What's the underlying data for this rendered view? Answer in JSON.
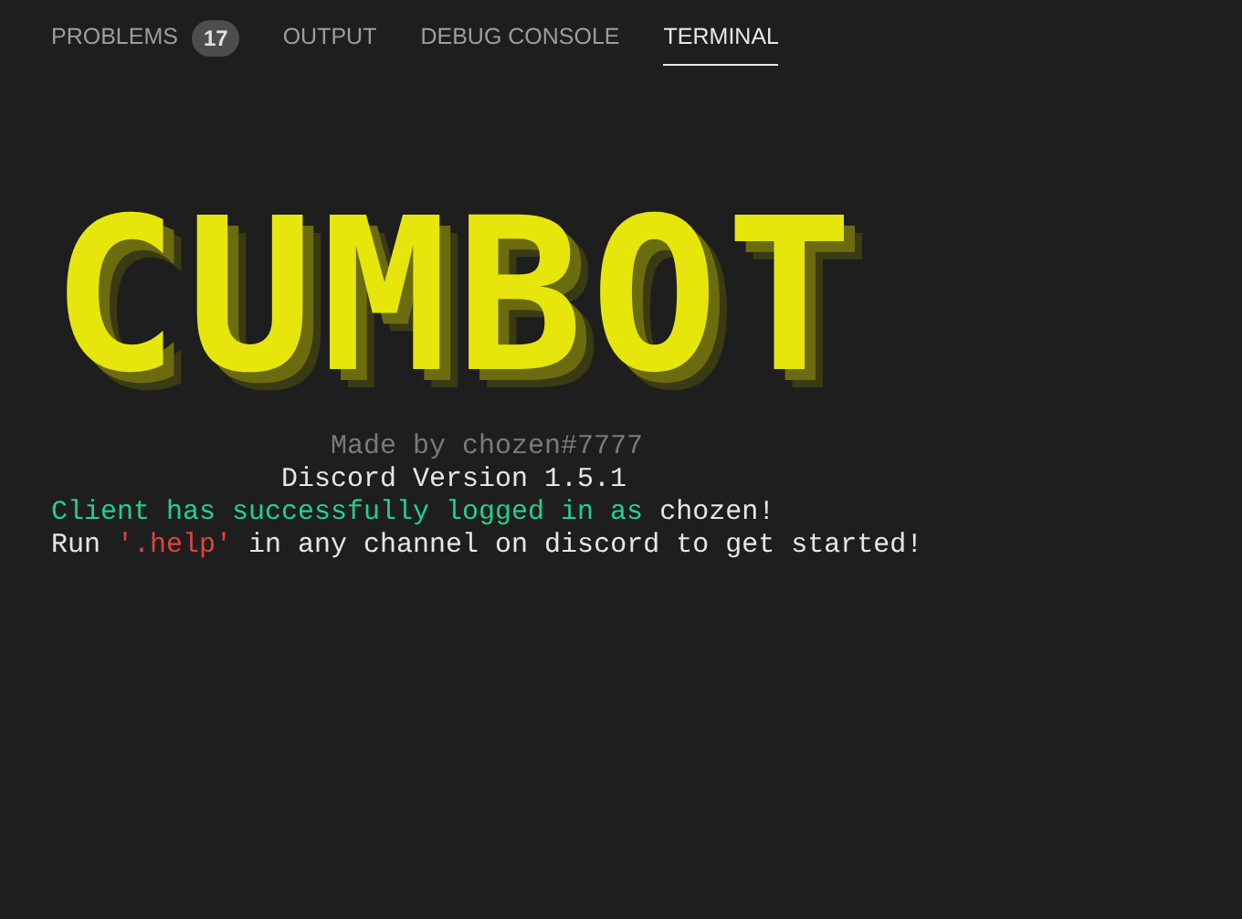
{
  "tabs": [
    {
      "label": "PROBLEMS",
      "badge": "17",
      "selected": false
    },
    {
      "label": "OUTPUT",
      "selected": false
    },
    {
      "label": "DEBUG CONSOLE",
      "selected": false
    },
    {
      "label": "TERMINAL",
      "selected": true
    }
  ],
  "terminal": {
    "banner": "CUMBOT",
    "lines": [
      {
        "segments": [
          {
            "kind": "dim",
            "text": "                 Made by chozen#7777"
          }
        ]
      },
      {
        "segments": [
          {
            "kind": "plain",
            "text": "              Discord Version 1.5.1"
          }
        ]
      },
      {
        "segments": [
          {
            "kind": "success",
            "text": "Client has successfully logged in as "
          },
          {
            "kind": "plain",
            "text": "chozen!"
          }
        ]
      },
      {
        "segments": [
          {
            "kind": "plain",
            "text": "Run "
          },
          {
            "kind": "string",
            "text": "'.help'"
          },
          {
            "kind": "plain",
            "text": " in any channel on discord to get started!"
          }
        ]
      }
    ]
  }
}
